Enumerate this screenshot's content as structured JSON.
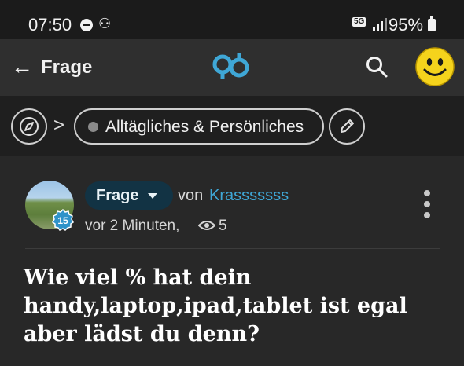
{
  "status_bar": {
    "time": "07:50",
    "network": "5G",
    "battery_percent": "95%",
    "icons": [
      "do-not-disturb-icon",
      "app-notification-icon",
      "signal-icon",
      "battery-icon"
    ]
  },
  "app_bar": {
    "back_icon": "arrow-left-icon",
    "title": "Frage",
    "logo": "gutefrage-logo",
    "search_icon": "search-icon",
    "profile_icon": "smiley-avatar"
  },
  "breadcrumb": {
    "compass_icon": "compass-icon",
    "separator": ">",
    "topic": "Alltägliches & Persönliches",
    "edit_icon": "pencil-icon"
  },
  "post": {
    "type_label": "Frage",
    "by_prefix": "von",
    "author": "Krasssssss",
    "level": "15",
    "time": "vor 2 Minuten,",
    "views": "5",
    "title": "Wie viel % hat dein handy,laptop,ipad,tablet ist egal aber lädst du denn?"
  },
  "colors": {
    "background": "#282828",
    "appbar": "#2f2f2f",
    "breadcrumb_bar": "#1f1f1f",
    "accent_blue": "#3fa7d6",
    "type_pill": "#123344"
  }
}
